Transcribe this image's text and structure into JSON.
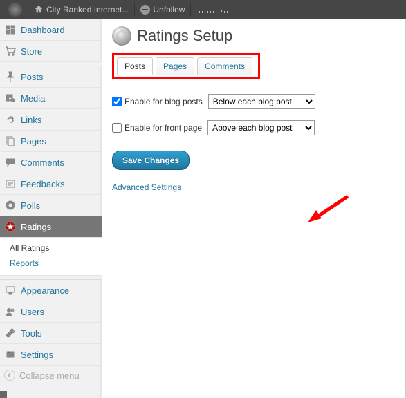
{
  "adminbar": {
    "site_title": "City Ranked Internet...",
    "unfollow": "Unfollow"
  },
  "sidebar": {
    "dashboard": "Dashboard",
    "store": "Store",
    "posts": "Posts",
    "media": "Media",
    "links": "Links",
    "pages": "Pages",
    "comments": "Comments",
    "feedbacks": "Feedbacks",
    "polls": "Polls",
    "ratings": "Ratings",
    "ratings_sub": {
      "all": "All Ratings",
      "reports": "Reports"
    },
    "appearance": "Appearance",
    "users": "Users",
    "tools": "Tools",
    "settings": "Settings",
    "collapse": "Collapse menu"
  },
  "page": {
    "title": "Ratings Setup",
    "tabs": {
      "posts": "Posts",
      "pages": "Pages",
      "comments": "Comments"
    },
    "row1": {
      "checked": true,
      "label": "Enable for blog posts",
      "select_value": "Below each blog post"
    },
    "row2": {
      "checked": false,
      "label": "Enable for front page",
      "select_value": "Above each blog post"
    },
    "save": "Save Changes",
    "advanced": "Advanced Settings"
  }
}
